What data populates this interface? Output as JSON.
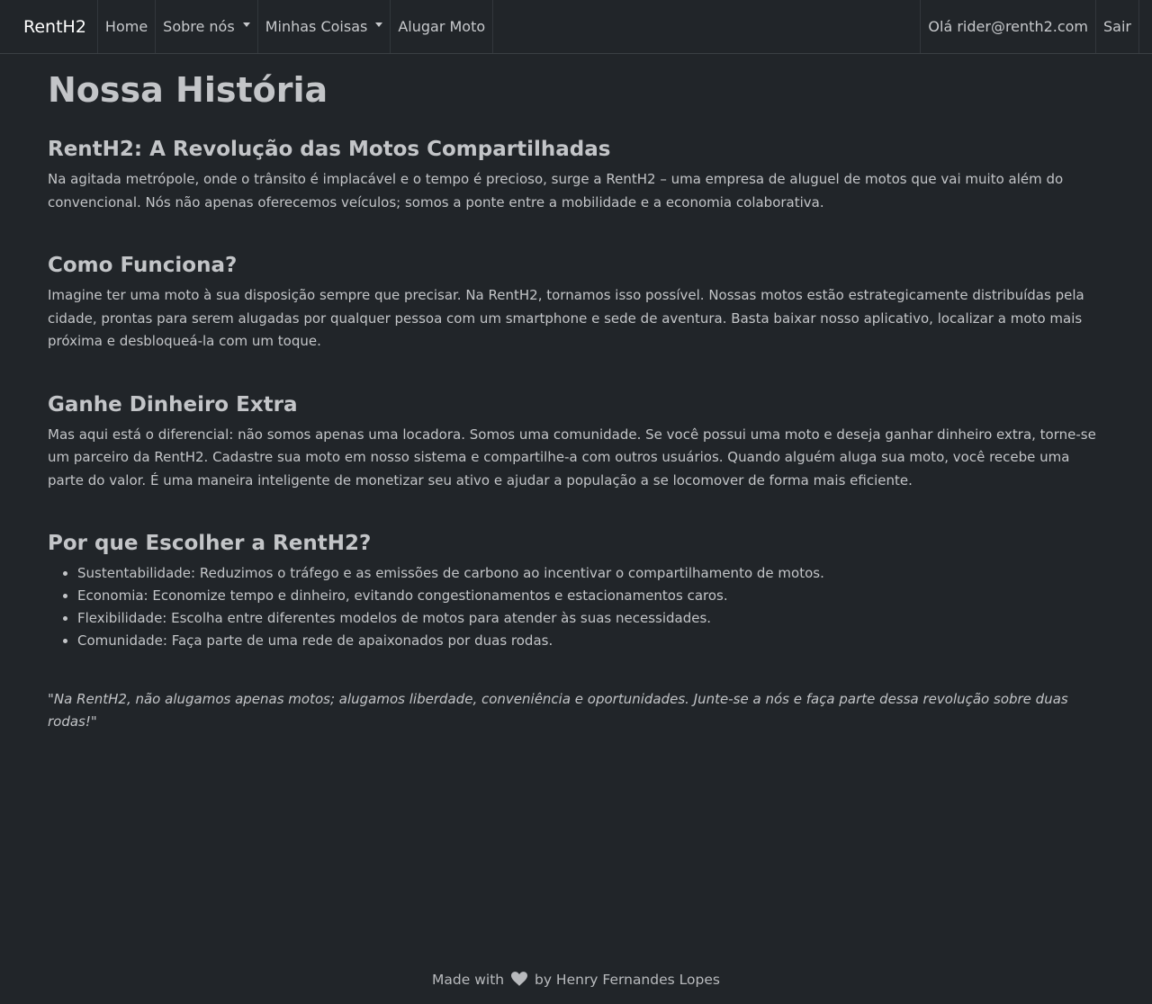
{
  "navbar": {
    "brand": "RentH2",
    "items": [
      {
        "label": "Home",
        "dropdown": false
      },
      {
        "label": "Sobre nós",
        "dropdown": true
      },
      {
        "label": "Minhas Coisas",
        "dropdown": true
      },
      {
        "label": "Alugar Moto",
        "dropdown": false
      }
    ],
    "greeting": "Olá rider@renth2.com",
    "logout": "Sair"
  },
  "main": {
    "title": "Nossa História",
    "sections": [
      {
        "heading": "RentH2: A Revolução das Motos Compartilhadas",
        "text": "Na agitada metrópole, onde o trânsito é implacável e o tempo é precioso, surge a RentH2 – uma empresa de aluguel de motos que vai muito além do convencional. Nós não apenas oferecemos veículos; somos a ponte entre a mobilidade e a economia colaborativa."
      },
      {
        "heading": "Como Funciona?",
        "text": "Imagine ter uma moto à sua disposição sempre que precisar. Na RentH2, tornamos isso possível. Nossas motos estão estrategicamente distribuídas pela cidade, prontas para serem alugadas por qualquer pessoa com um smartphone e sede de aventura. Basta baixar nosso aplicativo, localizar a moto mais próxima e desbloqueá-la com um toque."
      },
      {
        "heading": "Ganhe Dinheiro Extra",
        "text": "Mas aqui está o diferencial: não somos apenas uma locadora. Somos uma comunidade. Se você possui uma moto e deseja ganhar dinheiro extra, torne-se um parceiro da RentH2. Cadastre sua moto em nosso sistema e compartilhe-a com outros usuários. Quando alguém aluga sua moto, você recebe uma parte do valor. É uma maneira inteligente de monetizar seu ativo e ajudar a população a se locomover de forma mais eficiente."
      }
    ],
    "why": {
      "heading": "Por que Escolher a RentH2?",
      "items": [
        "Sustentabilidade: Reduzimos o tráfego e as emissões de carbono ao incentivar o compartilhamento de motos.",
        "Economia: Economize tempo e dinheiro, evitando congestionamentos e estacionamentos caros.",
        "Flexibilidade: Escolha entre diferentes modelos de motos para atender às suas necessidades.",
        "Comunidade: Faça parte de uma rede de apaixonados por duas rodas."
      ]
    },
    "quote": "\"Na RentH2, não alugamos apenas motos; alugamos liberdade, conveniência e oportunidades. Junte-se a nós e faça parte dessa revolução sobre duas rodas!\""
  },
  "footer": {
    "prefix": "Made with",
    "icon": "heart-icon",
    "suffix": "by Henry Fernandes Lopes"
  }
}
